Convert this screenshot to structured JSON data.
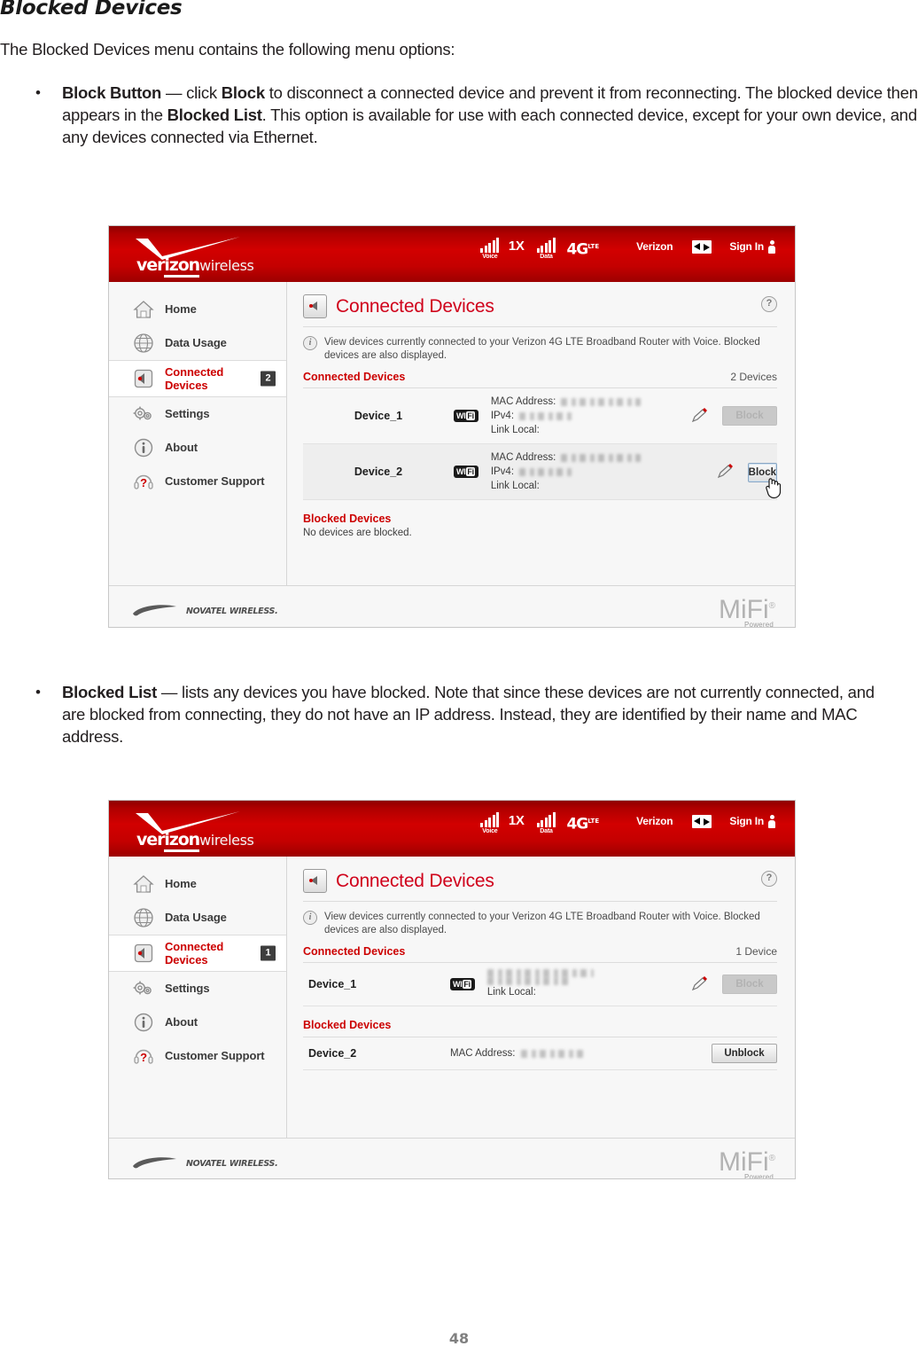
{
  "document": {
    "heading": "Blocked Devices",
    "intro": "The Blocked Devices menu contains the following menu options:",
    "page_number": "48",
    "bullets": [
      {
        "term": "Block Button",
        "dash": " — click ",
        "emph1": "Block",
        "text1": " to disconnect a connected device and prevent it from reconnecting. The blocked device then appears in the ",
        "emph2": "Blocked List",
        "text2": ". This option is available for use with each connected device, except for your own device, and any devices connected via Ethernet."
      },
      {
        "term": "Blocked List",
        "dash": " — lists any devices you have blocked. Note that since these devices are not currently connected, and are blocked from connecting, they do not have an IP address. Instead, they are identified by their name and MAC address."
      }
    ]
  },
  "colors": {
    "verizon_red": "#cc0000",
    "banner_red": "#d20000",
    "title_red": "#d0021b",
    "badge_dark": "#3d3d3d"
  },
  "banner": {
    "brand": "verizon",
    "brand_prefix": "ver",
    "brand_mid": "izon",
    "brand_sub": "wireless",
    "voice_label": "Voice",
    "tech_1x": "1X",
    "data_label": "Data",
    "tech_4g": "4G",
    "tech_4g_sup": "LTE",
    "carrier": "Verizon",
    "transfer_icon": "transfer-icon",
    "signin": "Sign In",
    "person_icon": "person-icon"
  },
  "sidebar": {
    "items": [
      {
        "label": "Home",
        "icon": "home-icon",
        "active": false,
        "badge": null
      },
      {
        "label": "Data Usage",
        "icon": "globe-icon",
        "active": false,
        "badge": null
      },
      {
        "label_line1": "Connected",
        "label_line2": "Devices",
        "icon": "speaker-icon",
        "active": true,
        "badge_shot1": "2",
        "badge_shot2": "1"
      },
      {
        "label": "Settings",
        "icon": "gears-icon",
        "active": false,
        "badge": null
      },
      {
        "label": "About",
        "icon": "info-circle-icon",
        "active": false,
        "badge": null
      },
      {
        "label": "Customer Support",
        "icon": "headset-question-icon",
        "active": false,
        "badge": null
      }
    ]
  },
  "main": {
    "page_title": "Connected Devices",
    "speaker_icon": "speaker-icon",
    "help_icon": "help-icon",
    "info_icon": "info-icon",
    "info_text": "View devices currently connected to your Verizon 4G LTE Broadband Router with Voice. Blocked devices are also displayed.",
    "section_connected": "Connected Devices",
    "section_blocked": "Blocked Devices",
    "mac_label": "MAC Address:",
    "ipv4_label": "IPv4:",
    "link_local_label": "Link Local:",
    "wifi_badge_wi": "WI",
    "wifi_badge_fi": "Fi",
    "edit_icon": "pencil-icon"
  },
  "screenshot1": {
    "device_count": "2 Devices",
    "rows": [
      {
        "name": "Device_1",
        "connection": "WiFi",
        "button": "Block",
        "button_state": "disabled"
      },
      {
        "name": "Device_2",
        "connection": "WiFi",
        "button": "Block",
        "button_state": "primary"
      }
    ],
    "blocked_empty_text": "No devices are blocked.",
    "cursor_icon": "hand-cursor-icon"
  },
  "screenshot2": {
    "device_count": "1 Device",
    "connected_rows": [
      {
        "name": "Device_1",
        "connection": "WiFi",
        "button": "Block",
        "button_state": "disabled"
      }
    ],
    "blocked_rows": [
      {
        "name": "Device_2",
        "mac_label": "MAC Address:",
        "button": "Unblock",
        "button_state": "plain"
      }
    ]
  },
  "footer": {
    "novatel_logo": "novatel-wireless-logo",
    "novatel_text": "NOVATEL WIRELESS.",
    "mifi_word": "MiFi",
    "mifi_reg": "®",
    "mifi_powered": "Powered"
  }
}
